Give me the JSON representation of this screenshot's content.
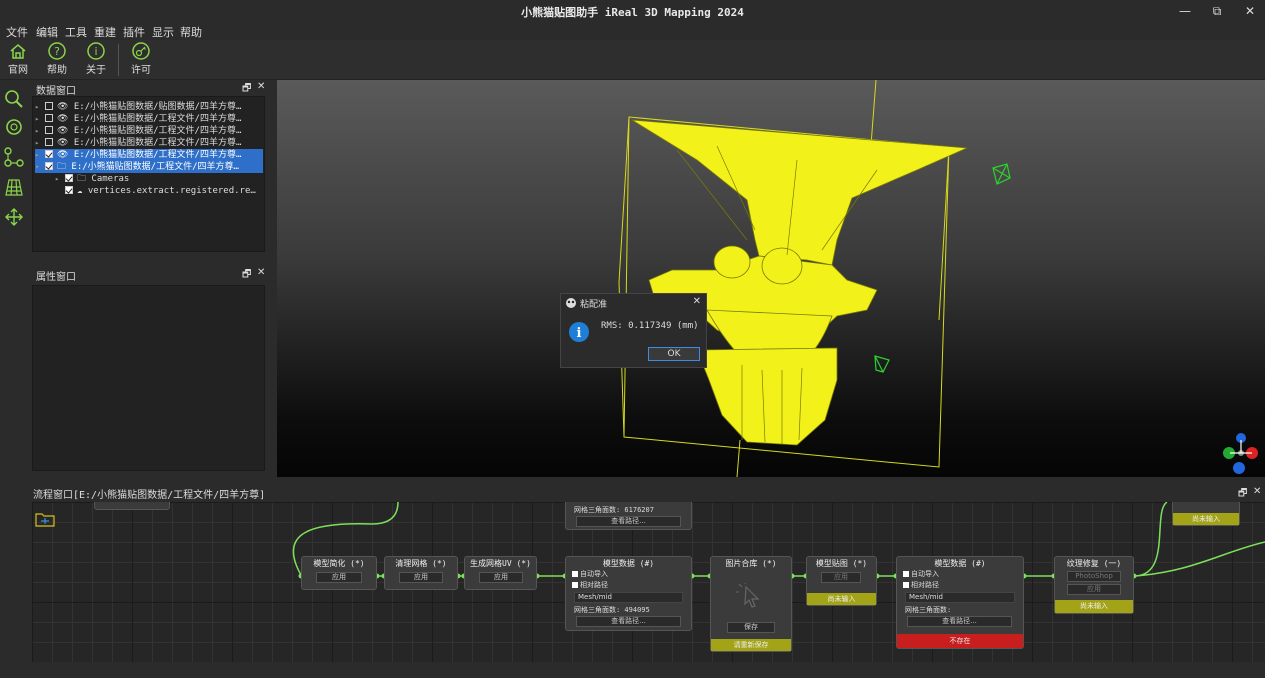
{
  "window": {
    "title": "小熊猫贴图助手 iReal 3D Mapping 2024",
    "minimize": "—",
    "restore": "⧉",
    "close": "✕"
  },
  "menu": [
    "文件",
    "编辑",
    "工具",
    "重建",
    "插件",
    "显示",
    "帮助"
  ],
  "ribbon": [
    {
      "label": "官网",
      "icon": "home-icon"
    },
    {
      "label": "帮助",
      "icon": "help-icon"
    },
    {
      "label": "关于",
      "icon": "info-icon"
    },
    {
      "label": "许可",
      "icon": "license-key-icon"
    }
  ],
  "data_window": {
    "title": "数据窗口",
    "float": "🗗",
    "close": "✕",
    "rows": [
      "E:/小熊猫贴图数据/贴图数据/四羊方尊…",
      "E:/小熊猫贴图数据/工程文件/四羊方尊…",
      "E:/小熊猫贴图数据/工程文件/四羊方尊…",
      "E:/小熊猫贴图数据/工程文件/四羊方尊…",
      "E:/小熊猫贴图数据/工程文件/四羊方尊…",
      "E:/小熊猫贴图数据/工程文件/四羊方尊…",
      "Cameras",
      "vertices.extract.registered.re…"
    ]
  },
  "property_window": {
    "title": "属性窗口",
    "float": "🗗",
    "close": "✕"
  },
  "dialog": {
    "title": "粘配准",
    "message": "RMS: 0.117349 (mm)",
    "ok": "OK",
    "close": "✕"
  },
  "flow_window": {
    "title": "流程窗口[E:/小熊猫贴图数据/工程文件/四羊方尊]",
    "float": "🗗",
    "close": "✕"
  },
  "nodes": {
    "top_partial": {
      "text": "网格三角面数: 6176207",
      "button": "查看路径..."
    },
    "simplify": {
      "title": "模型简化 (*)",
      "button": "应用"
    },
    "clean": {
      "title": "清理网格 (*)",
      "button": "应用"
    },
    "uv": {
      "title": "生成网格UV (*)",
      "button": "应用"
    },
    "model1": {
      "title": "模型数据 (#)",
      "auto_import": "自动导入",
      "relative": "相对路径",
      "path": "Mesh/mid",
      "count": "网格三角面数: 494095",
      "button": "查看路径..."
    },
    "pics": {
      "title": "图片合库 (*)",
      "save": "保存",
      "status": "请重新保存"
    },
    "texture": {
      "title": "模型贴图 (*)",
      "button": "应用",
      "status": "尚未输入"
    },
    "model2": {
      "title": "模型数据 (#)",
      "auto_import": "自动导入",
      "relative": "相对路径",
      "path": "Mesh/mid",
      "count": "网格三角面数:",
      "button": "查看路径...",
      "status": "不存在"
    },
    "fix": {
      "title": "纹理修复 (一)",
      "select": "PhotoShop",
      "button": "应用",
      "status": "尚未输入"
    },
    "right_partial": {
      "status": "尚未输入"
    }
  },
  "colors": {
    "accent": "#3c8de0",
    "model": "#f2f21a",
    "bbox": "#d8d81e",
    "link": "#7ee05a",
    "selected": "#2e6fc9",
    "warn": "#c81e1e",
    "pending": "#a3a318"
  }
}
